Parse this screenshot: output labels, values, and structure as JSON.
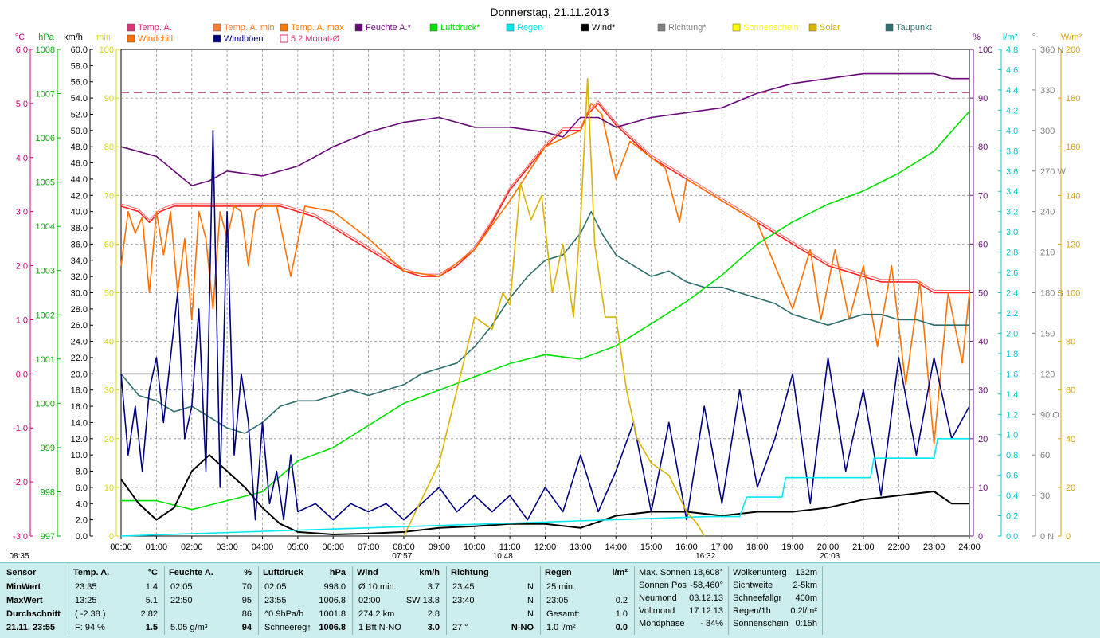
{
  "title": "Donnerstag, 21.11.2013",
  "legend": [
    {
      "label": "Temp. A.",
      "color": "#e0307a",
      "marker": "square"
    },
    {
      "label": "Temp. A. min",
      "color": "#ff7b31",
      "marker": "square"
    },
    {
      "label": "Temp. A. max",
      "color": "#ff7b00",
      "marker": "square"
    },
    {
      "label": "Feuchte A.*",
      "color": "#6a0a7a",
      "marker": "square"
    },
    {
      "label": "Luftdruck*",
      "color": "#00e000",
      "marker": "square"
    },
    {
      "label": "Regen",
      "color": "#00e8f0",
      "marker": "square"
    },
    {
      "label": "Wind*",
      "color": "#000000",
      "marker": "square"
    },
    {
      "label": "Richtung*",
      "color": "#808080",
      "marker": "square"
    },
    {
      "label": "Sonnenschein",
      "color": "#ffff00",
      "marker": "square"
    },
    {
      "label": "Solar",
      "color": "#d8b400",
      "marker": "square"
    },
    {
      "label": "Taupunkt",
      "color": "#2e6e6e",
      "marker": "square"
    },
    {
      "label": "Windchill",
      "color": "#ff7000",
      "marker": "square"
    },
    {
      "label": "Windböen",
      "color": "#000080",
      "marker": "square"
    },
    {
      "label": "5.2 Monat-Ø",
      "color": "#e0307a",
      "marker": "outline"
    }
  ],
  "axis_units": {
    "temp": "°C",
    "pressure": "hPa",
    "wind": "km/h",
    "sun": "min",
    "humidity": "%",
    "rain": "l/m²",
    "direction": "°",
    "solar": "W/m²"
  },
  "axes": {
    "temp_ticks": [
      "6.0",
      "5.0",
      "4.0",
      "3.0",
      "2.0",
      "1.0",
      "0.0",
      "-1.0",
      "-2.0",
      "-3.0"
    ],
    "pressure_ticks": [
      "1008",
      "1007",
      "1006",
      "1005",
      "1004",
      "1003",
      "1002",
      "1001",
      "1000",
      "999",
      "998",
      "997"
    ],
    "wind_ticks": [
      "60.0",
      "58.0",
      "56.0",
      "54.0",
      "52.0",
      "50.0",
      "48.0",
      "46.0",
      "44.0",
      "42.0",
      "40.0",
      "38.0",
      "36.0",
      "34.0",
      "32.0",
      "30.0",
      "28.0",
      "26.0",
      "24.0",
      "22.0",
      "20.0",
      "18.0",
      "16.0",
      "14.0",
      "12.0",
      "10.0",
      "8.0",
      "6.0",
      "4.0",
      "2.0",
      "0.0"
    ],
    "sun_ticks": [
      "100",
      "90",
      "80",
      "70",
      "60",
      "50",
      "40",
      "30",
      "20",
      "10",
      "0"
    ],
    "humidity_ticks": [
      "100",
      "90",
      "80",
      "70",
      "60",
      "50",
      "40",
      "30",
      "20",
      "10",
      "0"
    ],
    "rain_ticks": [
      "4.8",
      "4.6",
      "4.4",
      "4.2",
      "4.0",
      "3.8",
      "3.6",
      "3.4",
      "3.2",
      "3.0",
      "2.8",
      "2.6",
      "2.4",
      "2.2",
      "2.0",
      "1.8",
      "1.6",
      "1.4",
      "1.2",
      "1.0",
      "0.8",
      "0.6",
      "0.4",
      "0.2",
      "0.0"
    ],
    "direction_ticks": [
      "360 N",
      "330",
      "300",
      "270 W",
      "240",
      "210",
      "180 S",
      "150",
      "120",
      "90  O",
      "60",
      "30",
      "0  N"
    ],
    "solar_ticks": [
      "200",
      "180",
      "160",
      "140",
      "120",
      "100",
      "80",
      "60",
      "40",
      "20",
      "0"
    ],
    "time_ticks": [
      "00:00",
      "01:00",
      "02:00",
      "03:00",
      "04:00",
      "05:00",
      "06:00",
      "07:00",
      "08:00",
      "09:00",
      "10:00",
      "11:00",
      "12:00",
      "13:00",
      "14:00",
      "15:00",
      "16:00",
      "17:00",
      "18:00",
      "19:00",
      "20:00",
      "21:00",
      "22:00",
      "23:00",
      "24:00"
    ]
  },
  "markers": {
    "current_time": "08:35",
    "sunrise": "07:57",
    "max_sun": "10:48",
    "sunset": "16:32",
    "moon": "20:03"
  },
  "chart_data": {
    "type": "line",
    "x_unit": "hours",
    "ylim_temp": [
      -3,
      6
    ],
    "ylim_humidity": [
      0,
      100
    ],
    "ylim_pressure": [
      997,
      1008
    ],
    "ylim_wind": [
      0,
      60
    ],
    "ylim_rain": [
      0,
      5
    ],
    "ylim_solar": [
      0,
      200
    ],
    "monthly_avg_temp": 5.2,
    "series": [
      {
        "name": "Temp. A.",
        "axis": "temp",
        "color": "#ff2020",
        "x": [
          0,
          0.5,
          0.8,
          1.1,
          1.5,
          2,
          2.5,
          3,
          3.5,
          4,
          4.5,
          5,
          5.5,
          6,
          6.5,
          7,
          7.5,
          8,
          8.5,
          9,
          9.5,
          10,
          10.5,
          11,
          11.5,
          12,
          12.5,
          13,
          13.2,
          13.5,
          14,
          14.5,
          15,
          15.5,
          16,
          16.5,
          17,
          17.5,
          18,
          18.5,
          19,
          19.5,
          20,
          20.5,
          21,
          21.5,
          22,
          22.5,
          23,
          23.5,
          24
        ],
        "y": [
          3.1,
          3.0,
          2.8,
          3.0,
          3.1,
          3.1,
          3.1,
          3.1,
          3.1,
          3.1,
          3.1,
          3.0,
          2.9,
          2.7,
          2.5,
          2.3,
          2.1,
          1.9,
          1.8,
          1.8,
          2.0,
          2.3,
          2.8,
          3.4,
          3.8,
          4.2,
          4.5,
          4.5,
          4.8,
          5.0,
          4.6,
          4.3,
          4.0,
          3.8,
          3.6,
          3.4,
          3.2,
          3.0,
          2.8,
          2.6,
          2.4,
          2.2,
          2.0,
          1.9,
          1.8,
          1.7,
          1.7,
          1.7,
          1.5,
          1.5,
          1.5
        ]
      },
      {
        "name": "Windchill",
        "axis": "temp",
        "color": "#ff7000",
        "x": [
          0,
          0.2,
          0.4,
          0.6,
          0.8,
          1.0,
          1.2,
          1.4,
          1.6,
          1.8,
          2.0,
          2.2,
          2.4,
          2.6,
          2.8,
          3.0,
          3.2,
          3.4,
          3.6,
          3.8,
          4.0,
          4.4,
          4.8,
          5.2,
          6,
          7,
          8,
          9,
          10,
          11,
          12,
          13,
          13.3,
          13.6,
          14,
          14.4,
          15,
          15.4,
          15.8,
          16,
          17,
          18,
          19,
          19.5,
          19.8,
          20.2,
          20.6,
          21,
          21.4,
          21.8,
          22.2,
          22.6,
          23,
          23.4,
          23.8,
          24
        ],
        "y": [
          2.0,
          3.0,
          2.6,
          2.9,
          1.5,
          3.0,
          2.2,
          3.0,
          1.5,
          2.5,
          1.0,
          3.0,
          2.5,
          1.2,
          3.0,
          2.5,
          3.1,
          3.0,
          2.0,
          3.0,
          3.1,
          3.1,
          1.8,
          3.1,
          3.0,
          2.5,
          1.9,
          1.8,
          2.3,
          3.2,
          4.2,
          4.5,
          5.0,
          4.8,
          3.6,
          4.3,
          4.0,
          3.8,
          2.8,
          3.6,
          3.2,
          2.8,
          1.2,
          2.3,
          1.0,
          2.3,
          1.0,
          2.0,
          0.5,
          2.0,
          -0.2,
          1.7,
          -1.3,
          1.5,
          0.2,
          1.5
        ]
      },
      {
        "name": "Feuchte A.*",
        "axis": "humidity",
        "color": "#6a0a7a",
        "x": [
          0,
          1,
          1.5,
          2,
          2.5,
          3,
          4,
          5,
          6,
          7,
          8,
          9,
          10,
          11,
          12,
          12.5,
          13,
          13.5,
          14,
          15,
          16,
          17,
          18,
          19,
          20,
          21,
          22,
          23,
          23.5,
          24
        ],
        "y": [
          80,
          78,
          75,
          72,
          73,
          75,
          74,
          76,
          80,
          83,
          85,
          86,
          84,
          84,
          83,
          82,
          86,
          86,
          84,
          86,
          87,
          88,
          91,
          93,
          94,
          95,
          95,
          95,
          94,
          94
        ]
      },
      {
        "name": "Taupunkt",
        "axis": "temp",
        "color": "#2e6e6e",
        "x": [
          0,
          0.5,
          1,
          1.5,
          2,
          2.5,
          3,
          3.5,
          4,
          4.5,
          5,
          5.5,
          6,
          6.5,
          7,
          7.5,
          8,
          8.5,
          9,
          9.5,
          10,
          10.5,
          11,
          11.5,
          12,
          12.5,
          13,
          13.3,
          13.6,
          14,
          14.5,
          15,
          15.5,
          16,
          16.5,
          17,
          17.5,
          18,
          18.5,
          19,
          19.5,
          20,
          20.5,
          21,
          21.5,
          22,
          22.5,
          23,
          23.5,
          24
        ],
        "y": [
          0.0,
          -0.4,
          -0.5,
          -0.7,
          -0.6,
          -0.8,
          -1.0,
          -1.1,
          -0.9,
          -0.6,
          -0.5,
          -0.5,
          -0.4,
          -0.3,
          -0.4,
          -0.3,
          -0.2,
          0.0,
          0.1,
          0.2,
          0.5,
          0.9,
          1.4,
          1.8,
          2.1,
          2.2,
          2.6,
          3.0,
          2.6,
          2.2,
          2.0,
          1.8,
          1.9,
          1.7,
          1.6,
          1.6,
          1.5,
          1.4,
          1.3,
          1.1,
          1.0,
          0.9,
          1.0,
          1.1,
          1.1,
          1.0,
          1.0,
          0.9,
          0.9,
          0.9
        ]
      },
      {
        "name": "Luftdruck*",
        "axis": "pressure",
        "color": "#00e000",
        "x": [
          0,
          1,
          2,
          3,
          4,
          5,
          6,
          7,
          8,
          9,
          10,
          11,
          12,
          13,
          14,
          15,
          16,
          17,
          18,
          19,
          20,
          21,
          22,
          23,
          24
        ],
        "y": [
          997.8,
          997.8,
          997.6,
          997.8,
          998.0,
          998.7,
          999.0,
          999.5,
          1000.0,
          1000.3,
          1000.6,
          1000.9,
          1001.1,
          1001.0,
          1001.3,
          1001.8,
          1002.3,
          1002.9,
          1003.6,
          1004.1,
          1004.5,
          1004.8,
          1005.2,
          1005.7,
          1006.6
        ]
      },
      {
        "name": "Wind*",
        "axis": "wind",
        "color": "#000000",
        "x": [
          0,
          0.5,
          1,
          1.5,
          2,
          2.5,
          3,
          3.5,
          4,
          4.5,
          5,
          6,
          7,
          8,
          9,
          10,
          11,
          12,
          13,
          14,
          15,
          16,
          17,
          18,
          19,
          20,
          21,
          22,
          23,
          23.5,
          24
        ],
        "y": [
          7.0,
          4.0,
          2.0,
          3.5,
          8.0,
          10.0,
          8.0,
          6.0,
          3.5,
          1.5,
          0.5,
          0.2,
          0.3,
          0.5,
          1.0,
          1.2,
          1.5,
          1.5,
          1.0,
          2.5,
          3.0,
          3.0,
          2.5,
          3.0,
          3.0,
          3.5,
          4.5,
          5.0,
          5.5,
          4.0,
          4.0
        ]
      },
      {
        "name": "Windböen",
        "axis": "wind",
        "color": "#000080",
        "x": [
          0,
          0.2,
          0.4,
          0.6,
          0.8,
          1.0,
          1.2,
          1.4,
          1.6,
          1.8,
          2.0,
          2.2,
          2.4,
          2.6,
          2.8,
          3.0,
          3.2,
          3.4,
          3.6,
          3.8,
          4.0,
          4.2,
          4.4,
          4.6,
          4.8,
          5.0,
          5.5,
          6.0,
          6.5,
          7.0,
          7.5,
          8.0,
          8.5,
          9.0,
          9.5,
          10,
          10.5,
          11,
          11.5,
          12,
          12.5,
          13,
          13.5,
          14,
          14.5,
          15,
          15.5,
          16,
          16.5,
          17,
          17.5,
          18,
          18.5,
          19,
          19.5,
          20,
          20.5,
          21,
          21.5,
          22,
          22.5,
          23,
          23.5,
          24
        ],
        "y": [
          20,
          10,
          16,
          8,
          18,
          22,
          14,
          22,
          30,
          12,
          16,
          28,
          8,
          50,
          6,
          40,
          10,
          20,
          14,
          2,
          14,
          4,
          8,
          2,
          10,
          3,
          4,
          2,
          4,
          3,
          4,
          2,
          4,
          6,
          3,
          5,
          3,
          5,
          2,
          6,
          3,
          10,
          3,
          8,
          14,
          3,
          14,
          2,
          16,
          4,
          18,
          6,
          12,
          20,
          4,
          22,
          8,
          18,
          5,
          22,
          10,
          22,
          12,
          16
        ]
      },
      {
        "name": "Regen",
        "axis": "rain",
        "color": "#00e8f0",
        "x": [
          0,
          16.6,
          17.5,
          17.7,
          18.7,
          18.8,
          21.2,
          21.3,
          23.0,
          23.1,
          24
        ],
        "y": [
          0,
          0.2,
          0.2,
          0.4,
          0.4,
          0.6,
          0.6,
          0.8,
          0.8,
          1.0,
          1.0
        ]
      },
      {
        "name": "Solar",
        "axis": "solar",
        "color": "#d8b400",
        "x": [
          8.0,
          8.5,
          9,
          9.5,
          10,
          10.5,
          10.8,
          11,
          11.3,
          11.6,
          11.9,
          12.2,
          12.5,
          12.8,
          13.0,
          13.2,
          13.4,
          13.7,
          14.0,
          14.3,
          14.6,
          15,
          15.5,
          16,
          16.3,
          16.5
        ],
        "y": [
          0,
          15,
          30,
          60,
          90,
          85,
          100,
          95,
          145,
          130,
          140,
          100,
          120,
          90,
          130,
          188,
          120,
          90,
          90,
          60,
          40,
          30,
          25,
          10,
          5,
          0
        ]
      }
    ]
  },
  "stats": {
    "headers": {
      "sensor": "Sensor",
      "temp": "Temp. A.",
      "temp_unit": "°C",
      "hum": "Feuchte A.",
      "hum_unit": "%",
      "press": "Luftdruck",
      "press_unit": "hPa",
      "wind": "Wind",
      "wind_unit": "km/h",
      "dir": "Richtung",
      "rain": "Regen",
      "rain_unit": "l/m²"
    },
    "labels": [
      "MinWert",
      "MaxWert",
      "Durchschnitt",
      "21.11. 23:55"
    ],
    "temp": [
      [
        "23:35",
        "1.4"
      ],
      [
        "13:25",
        "5.1"
      ],
      [
        "( -2.38 )",
        "2.82"
      ],
      [
        "F: 94 %",
        "1.5"
      ]
    ],
    "hum": [
      [
        "02:05",
        "70"
      ],
      [
        "22:50",
        "95"
      ],
      [
        "",
        "86"
      ],
      [
        "5.05 g/m³",
        "94"
      ]
    ],
    "press": [
      [
        "02:05",
        "998.0"
      ],
      [
        "23:55",
        "1006.8"
      ],
      [
        "^0.9hPa/h",
        "1001.8"
      ],
      [
        "Schneereg↑",
        "1006.8"
      ]
    ],
    "wind": [
      [
        "Ø 10 min.",
        "3.7"
      ],
      [
        "02:00",
        "SW 13.8"
      ],
      [
        "274.2 km",
        "2.8"
      ],
      [
        "1 Bft N-NO",
        "3.0"
      ]
    ],
    "dir": [
      [
        "23:45",
        "N"
      ],
      [
        "23:40",
        "N"
      ],
      [
        "",
        "N"
      ],
      [
        "27 °",
        "N-NO"
      ]
    ],
    "rain": [
      [
        "25 min.",
        ""
      ],
      [
        "23:05",
        "0.2"
      ],
      [
        "Gesamt:",
        "1.0"
      ],
      [
        "1.0 l/m²",
        "0.0"
      ]
    ],
    "astro": [
      [
        "Max. Sonnen",
        "18,608°"
      ],
      [
        "Sonnen Pos",
        "-58,460°"
      ],
      [
        "Neumond",
        "03.12.13"
      ],
      [
        "Vollmond",
        "17.12.13"
      ],
      [
        "Mondphase",
        "- 84%"
      ]
    ],
    "weather": [
      [
        "Wolkenunterg",
        "132m"
      ],
      [
        "Sichtweite",
        "2-5km"
      ],
      [
        "Schneefallgr",
        "400m"
      ],
      [
        "Regen/1h",
        "0.2l/m²"
      ],
      [
        "Sonnenschein",
        "0:15h"
      ]
    ]
  }
}
